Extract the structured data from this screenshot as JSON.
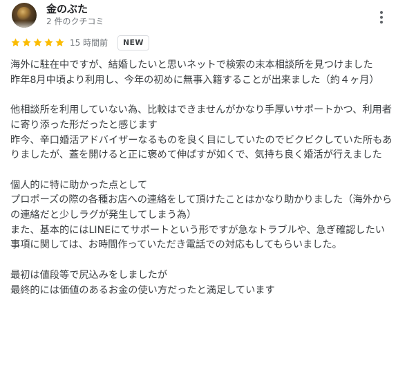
{
  "reviewer": {
    "name": "金のぶた",
    "review_count": "2 件のクチコミ",
    "avatar": "reviewer-avatar-coin"
  },
  "rating": {
    "stars": 5,
    "max": 5,
    "color": "#fbbc04",
    "icon": "star-icon"
  },
  "time_ago": "15 時間前",
  "badge": "NEW",
  "menu_icon": "more-vert-icon",
  "review_lines": [
    "海外に駐在中ですが、結婚したいと思いネットで検索の末本相談所を見つけました",
    "昨年8月中頃より利用し、今年の初めに無事入籍することが出来ました（約４ヶ月）",
    "",
    "他相談所を利用していない為、比較はできませんがかなり手厚いサポートかつ、利用者に寄り添った形だったと感じます",
    "昨今、辛口婚活アドバイザーなるものを良く目にしていたのでビクビクしていた所もありましたが、蓋を開けると正に褒めて伸ばすが如くで、気持ち良く婚活が行えました",
    "",
    "個人的に特に助かった点として",
    "プロポーズの際の各種お店への連絡をして頂けたことはかなり助かりました（海外からの連絡だと少しラグが発生してしまう為）",
    "また、基本的にはLINEにてサポートという形ですが急なトラブルや、急ぎ確認したい事項に関しては、お時間作っていただき電話での対応もしてもらいました。",
    "",
    "最初は値段等で尻込みをしましたが",
    "最終的には価値のあるお金の使い方だったと満足しています"
  ]
}
